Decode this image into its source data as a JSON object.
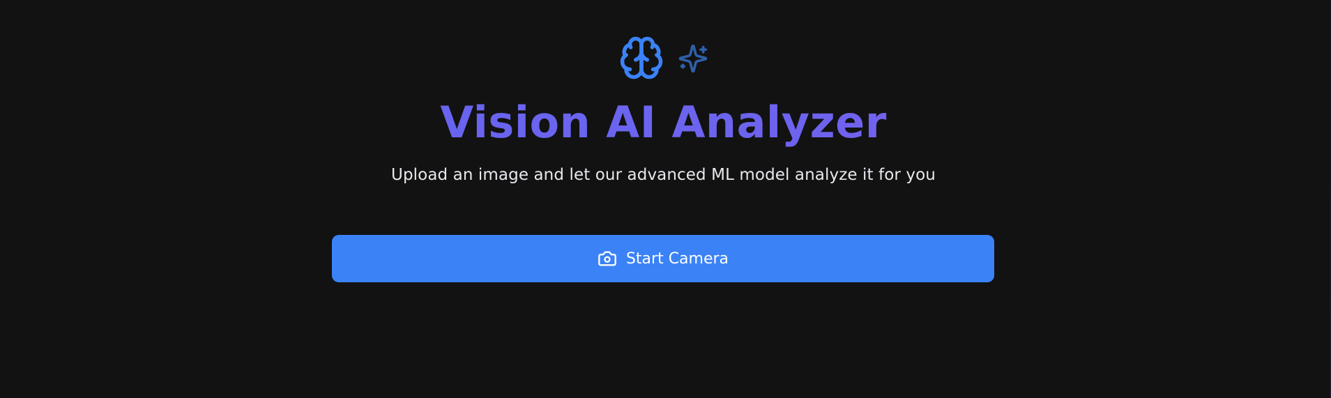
{
  "app": {
    "title": "Vision AI Analyzer",
    "subtitle": "Upload an image and let our advanced ML model analyze it for you"
  },
  "actions": {
    "start_camera_label": "Start Camera"
  },
  "icons": {
    "hero_primary": "brain-icon",
    "hero_secondary": "sparkles-icon",
    "button": "camera-icon"
  },
  "colors": {
    "background": "#121212",
    "title_gradient_start": "#6366f1",
    "title_gradient_end": "#8b5cf6",
    "brain_icon": "#3b82f6",
    "sparkle_icon": "#2f5fa8",
    "button_background": "#3b82f6",
    "button_text": "#ffffff",
    "subtitle_text": "#e8e8ee"
  }
}
